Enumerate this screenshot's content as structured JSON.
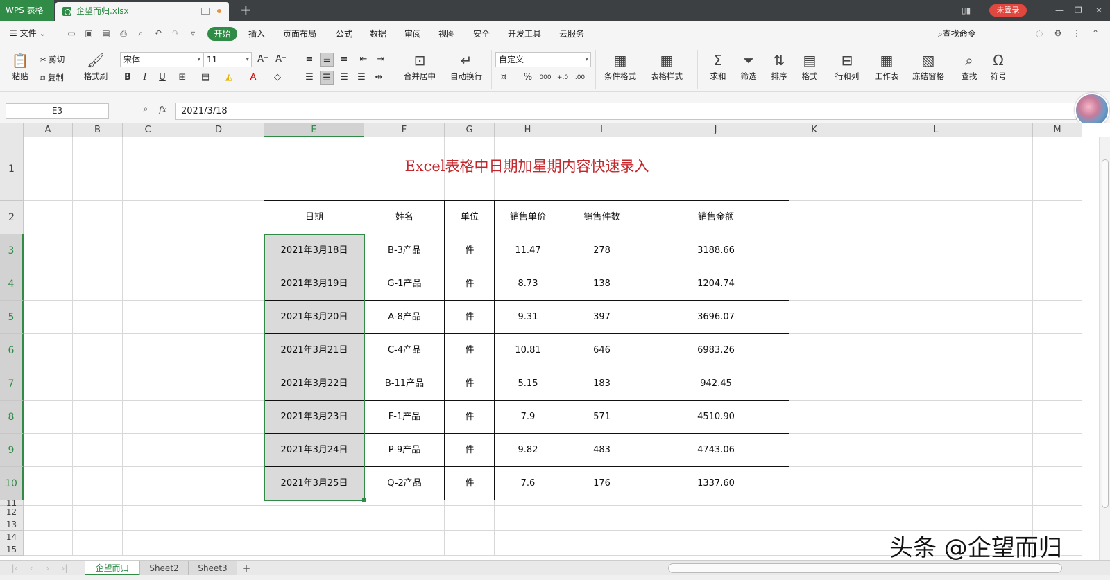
{
  "titlebar": {
    "app_name": "WPS 表格",
    "file_name": "企望而归.xlsx",
    "login_label": "未登录"
  },
  "menubar": {
    "file_label": "文件",
    "items": [
      "开始",
      "插入",
      "页面布局",
      "公式",
      "数据",
      "审阅",
      "视图",
      "安全",
      "开发工具",
      "云服务"
    ],
    "search_label": "查找命令"
  },
  "ribbon": {
    "paste": "粘贴",
    "cut": "剪切",
    "copy": "复制",
    "format_painter": "格式刷",
    "font_name": "宋体",
    "font_size": "11",
    "bold": "B",
    "italic": "I",
    "underline": "U",
    "merge_center": "合并居中",
    "wrap_text": "自动换行",
    "number_format": "自定义",
    "percent": "%",
    "thousands": "000",
    "cond_format": "条件格式",
    "table_style": "表格样式",
    "sum": "求和",
    "filter": "筛选",
    "sort": "排序",
    "format": "格式",
    "row_col": "行和列",
    "worksheet": "工作表",
    "freeze": "冻结窗格",
    "find": "查找",
    "symbol": "符号"
  },
  "formula": {
    "cell_ref": "E3",
    "fx_label": "fx",
    "value": "2021/3/18"
  },
  "grid": {
    "columns": [
      "A",
      "B",
      "C",
      "D",
      "E",
      "F",
      "G",
      "H",
      "I",
      "J",
      "K",
      "L",
      "M"
    ],
    "rows": [
      "1",
      "2",
      "3",
      "4",
      "5",
      "6",
      "7",
      "8",
      "9",
      "10",
      "11",
      "12",
      "13",
      "14",
      "15"
    ],
    "title": "Excel表格中日期加星期内容快速录入",
    "headers": [
      "日期",
      "姓名",
      "单位",
      "销售单价",
      "销售件数",
      "销售金额"
    ],
    "data": [
      [
        "2021年3月18日",
        "B-3产品",
        "件",
        "11.47",
        "278",
        "3188.66"
      ],
      [
        "2021年3月19日",
        "G-1产品",
        "件",
        "8.73",
        "138",
        "1204.74"
      ],
      [
        "2021年3月20日",
        "A-8产品",
        "件",
        "9.31",
        "397",
        "3696.07"
      ],
      [
        "2021年3月21日",
        "C-4产品",
        "件",
        "10.81",
        "646",
        "6983.26"
      ],
      [
        "2021年3月22日",
        "B-11产品",
        "件",
        "5.15",
        "183",
        "942.45"
      ],
      [
        "2021年3月23日",
        "F-1产品",
        "件",
        "7.9",
        "571",
        "4510.90"
      ],
      [
        "2021年3月24日",
        "P-9产品",
        "件",
        "9.82",
        "483",
        "4743.06"
      ],
      [
        "2021年3月25日",
        "Q-2产品",
        "件",
        "7.6",
        "176",
        "1337.60"
      ]
    ]
  },
  "sheets": [
    "企望而归",
    "Sheet2",
    "Sheet3"
  ],
  "watermark": "头条 @企望而归",
  "colors": {
    "accent": "#2f8b46",
    "title_red": "#c3262b",
    "login_red": "#e0473e"
  }
}
